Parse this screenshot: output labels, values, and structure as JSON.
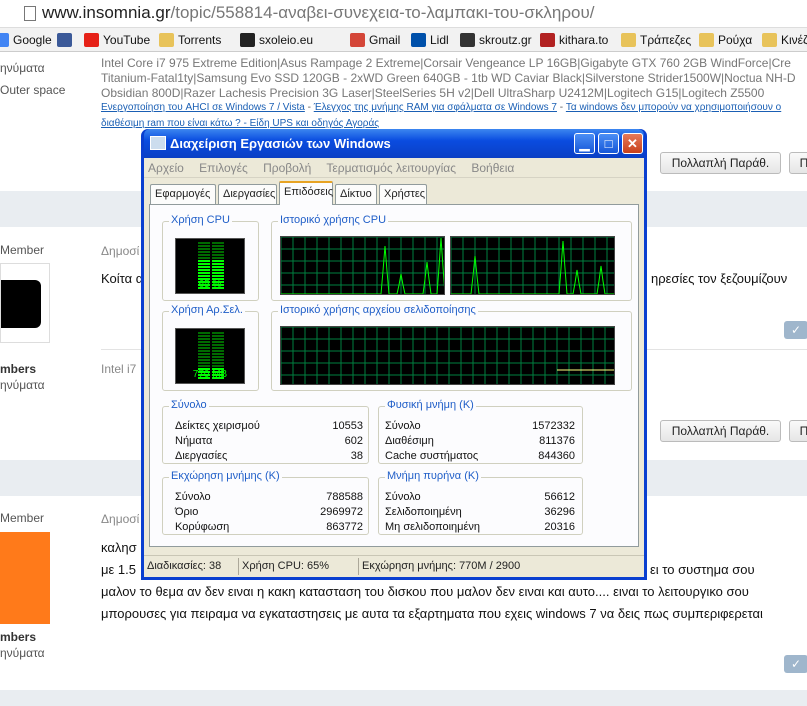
{
  "browser": {
    "url_host": "www.insomnia.gr",
    "url_path": "/topic/558814-αναβει-συνεχεια-το-λαμπακι-του-σκληρου/",
    "bookmarks": [
      {
        "label": "Google",
        "color": "#4285f4"
      },
      {
        "label": "YouTube",
        "color": "#e62117"
      },
      {
        "label": "Torrents",
        "color": "#e8c35a"
      },
      {
        "label": "sxoleio.eu",
        "color": "#777777"
      },
      {
        "label": "Gmail",
        "color": "#d44638"
      },
      {
        "label": "Lidl",
        "color": "#0050aa"
      },
      {
        "label": "skroutz.gr",
        "color": "#333333"
      },
      {
        "label": "kithara.to",
        "color": "#b22222"
      },
      {
        "label": "Τράπεζες",
        "color": "#e8c35a"
      },
      {
        "label": "Ρούχα",
        "color": "#e8c35a"
      },
      {
        "label": "Κινέζι",
        "color": "#e8c35a"
      }
    ],
    "bookmark_icons": {
      "google": "facebook-icon"
    }
  },
  "forum": {
    "left_fragments": [
      "ηνύματα",
      "Outer space",
      "Member",
      "mbers",
      "ηνύματα",
      "Member",
      "mbers",
      "ηνύματα"
    ],
    "sig_line1": "Intel Core i7 975 Extreme Edition|Asus Rampage 2 Extreme|Corsair Vengeance LP 16GB|Gigabyte GTX 760 2GB WindForce|Cre",
    "sig_line2": "Titanium-Fatal1ty|Samsung Evo SSD 120GB - 2xWD Green 640GB - 1tb WD Caviar Black|Silverstone Strider1500W|Noctua NH-D",
    "sig_line3": "Obsidian 800D|Razer Lachesis Precision 3G Laser|SteelSeries 5H v2|Dell UltraSharp U2412M|Logitech G15|Logitech Z5500",
    "sig_link1": "Ενεργοποίηση του AHCI σε Windows 7 / Vista",
    "sig_sep1": " - ",
    "sig_link2": "Έλεγχος της μνήμης RAM για σφάλματα σε Windows 7",
    "sig_sep2": " - ",
    "sig_link3": "Τα windows δεν μπορούν να χρησιμοποιήσουν ο",
    "sig_link4": "διαθέσιμη ram που είναι κάτω ? - Είδη UPS και οδηγός Αγοράς",
    "multi_quote": "Πολλαπλή Παράθ.",
    "p_btn": "Π",
    "posted1": "Δημοσί",
    "post1_text_a": "Κοίτα α",
    "post1_text_b": "ηρεσίες τον ξεζουμίζουν",
    "sig_short": "Intel i7",
    "posted2": "Δημοσί",
    "post2_line1": "καλησ",
    "post2_line2a": "με 1.5",
    "post2_line2b": "ει το συστημα σου",
    "post2_line3": "μαλον το θεμα αν δεν ειναι η κακη κατασταση του δισκου που μαλον δεν ειναι και αυτο.... ειναι το λειτουργικο σου",
    "post2_line4": "μπορουσες για πειραμα να εγκαταστησεις με αυτα τα εξαρτηματα που εχεις windows 7 να δεις πως συμπεριφερεται",
    "check": "✓"
  },
  "taskmgr": {
    "title": "Διαχείριση Εργασιών των Windows",
    "menu": [
      "Αρχείο",
      "Επιλογές",
      "Προβολή",
      "Τερματισμός λειτουργίας",
      "Βοήθεια"
    ],
    "tabs": [
      "Εφαρμογές",
      "Διεργασίες",
      "Επιδόσεις",
      "Δίκτυο",
      "Χρήστες"
    ],
    "active_tab": 2,
    "cpu_label": "Χρήση CPU",
    "cpu_value": "65 %",
    "cpu_fraction": 0.65,
    "cpu_history_label": "Ιστορικό χρήσης CPU",
    "pf_label": "Χρήση Αρ.Σελ.",
    "pf_value": "770 MB",
    "pf_fraction": 0.27,
    "pf_history_label": "Ιστορικό χρήσης αρχείου σελιδοποίησης",
    "totals": {
      "title": "Σύνολο",
      "rows": [
        [
          "Δείκτες χειρισμού",
          "10553"
        ],
        [
          "Νήματα",
          "602"
        ],
        [
          "Διεργασίες",
          "38"
        ]
      ]
    },
    "physical": {
      "title": "Φυσική μνήμη (K)",
      "rows": [
        [
          "Σύνολο",
          "1572332"
        ],
        [
          "Διαθέσιμη",
          "811376"
        ],
        [
          "Cache συστήματος",
          "844360"
        ]
      ]
    },
    "commit": {
      "title": "Εκχώρηση μνήμης (K)",
      "rows": [
        [
          "Σύνολο",
          "788588"
        ],
        [
          "Όριο",
          "2969972"
        ],
        [
          "Κορύφωση",
          "863772"
        ]
      ]
    },
    "kernel": {
      "title": "Μνήμη πυρήνα (K)",
      "rows": [
        [
          "Σύνολο",
          "56612"
        ],
        [
          "Σελιδοποιημένη",
          "36296"
        ],
        [
          "Μη σελιδοποιημένη",
          "20316"
        ]
      ]
    },
    "status": [
      "Διαδικασίες: 38",
      "Χρήση CPU: 65%",
      "Εκχώρηση μνήμης: 770M / 2900"
    ],
    "colors": {
      "graph_line": "#00ff00",
      "grid": "#008040",
      "title_bar": "#0a4ce0"
    }
  }
}
